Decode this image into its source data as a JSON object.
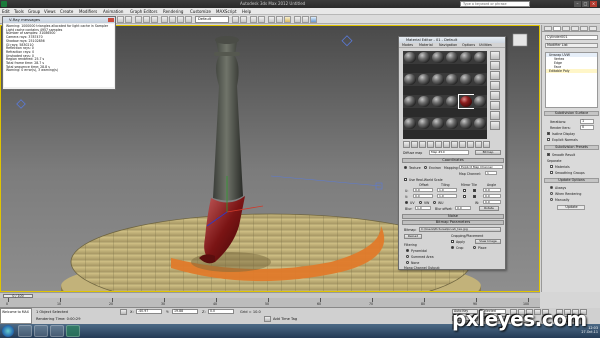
{
  "titlebar": {
    "title": "Autodesk 3ds Max 2012   Untitled",
    "search_placeholder": "Type a keyword or phrase"
  },
  "menus": [
    "Edit",
    "Tools",
    "Group",
    "Views",
    "Create",
    "Modifiers",
    "Animation",
    "Graph Editors",
    "Rendering",
    "Customize",
    "MAXScript",
    "Help"
  ],
  "toolbar": {
    "selection_filter": "All",
    "named_selection": "Default"
  },
  "viewport": {
    "label": "[ + ][Perspective][Smooth + Highlights]"
  },
  "vray_messages": {
    "title": "V-Ray messages",
    "lines": [
      "Warning: 1000000 triangles allocated for light cache in Sampler",
      "Light cache contains 4957 samples",
      "Number of samples: 31086500",
      "Camera rays: 3787470",
      "Shadow rays: 25102856",
      "GI rays: 5830210",
      "Reflection rays: 0",
      "Refraction rays: 0",
      "Unshaded rays: 0",
      "Region rendered: 25.7 s",
      "Total frame time: 28.7 s",
      "Total sequence time: 28.8 s",
      "Warning: 0 error(s), 3 warning(s)"
    ]
  },
  "command_panel": {
    "object_name": "Cylinder001",
    "modifier_list": "Modifier List",
    "stack": [
      "Unwrap UVW",
      "Vertex",
      "Edge",
      "Face",
      "Editable Poly"
    ],
    "rollouts": [
      "Subdivision Surface",
      "Subdivision Presets",
      "Update Options"
    ],
    "params": {
      "iterations_label": "Iterations:",
      "iterations": "1",
      "render_iters_label": "Render Iters:",
      "render_iters": "0",
      "isoline_label": "Isoline Display",
      "explicit_normals_label": "Explicit Normals",
      "smooth_result_label": "Smooth Result",
      "separate_label": "Separate",
      "materials_label": "Materials",
      "smoothing_groups_label": "Smoothing Groups",
      "always_label": "Always",
      "when_rendering_label": "When Rendering",
      "manually_label": "Manually",
      "update_label": "Update"
    }
  },
  "material_editor": {
    "title": "Material Editor - 01 - Default",
    "menu": [
      "Modes",
      "Material",
      "Navigation",
      "Options",
      "Utilities"
    ],
    "material_name": "Diffuse map",
    "map_name": "Map #10",
    "map_type": "Bitmap",
    "rollouts": [
      "Coordinates",
      "Noise",
      "Bitmap Parameters"
    ],
    "coords": {
      "texture_label": "Texture",
      "environ_label": "Environ",
      "mapping_label": "Mapping:",
      "mapping_value": "Explicit Map Channel",
      "map_channel_label": "Map Channel:",
      "map_channel_value": "1",
      "use_real_world": "Use Real-World Scale",
      "offset_label": "Offset",
      "tiling_label": "Tiling",
      "mirror_tile_label": "Mirror Tile",
      "angle_label": "Angle",
      "u_label": "U:",
      "v_label": "V:",
      "w_label": "W:",
      "u_offset": "0.0",
      "v_offset": "0.0",
      "u_tiling": "1.0",
      "v_tiling": "1.0",
      "u_angle": "0.0",
      "v_angle": "0.0",
      "w_angle": "0.0",
      "uv_label": "UV",
      "vw_label": "VW",
      "wu_label": "WU",
      "blur_label": "Blur:",
      "blur_value": "1.0",
      "blur_offset_label": "Blur offset:",
      "blur_offset_value": "0.0",
      "rotate_label": "Rotate"
    },
    "bitmap": {
      "bitmap_label": "Bitmap:",
      "bitmap_path": "C:\\Users\\Pictures\\brush_tex.jpg",
      "reload_label": "Reload",
      "cropping_label": "Cropping/Placement",
      "apply_label": "Apply",
      "view_image_label": "View Image",
      "crop_label": "Crop",
      "place_label": "Place",
      "filtering_label": "Filtering",
      "pyramidal_label": "Pyramidal",
      "summed_area_label": "Summed Area",
      "none_label": "None",
      "mono_channel_label": "Mono Channel Output:"
    }
  },
  "timeline": {
    "frame_label": "0 / 100",
    "ticks": [
      "0",
      "10",
      "20",
      "30",
      "40",
      "50",
      "60",
      "70",
      "80",
      "90",
      "100"
    ]
  },
  "statusbar": {
    "maxscript": "Welcome to MAX",
    "selected": "1 Object Selected",
    "rendering_time": "Rendering Time: 0:00:29",
    "x_label": "X:",
    "x_value": "-40.97",
    "y_label": "Y:",
    "y_value": "19.88",
    "z_label": "Z:",
    "z_value": "0.0",
    "grid": "Grid = 10.0",
    "auto_key": "Auto Key",
    "selected_btn": "Selected",
    "set_key": "Set Key",
    "key_filters": "Key Filters...",
    "add_time_tag": "Add Time Tag"
  },
  "taskbar": {
    "time": "12:03",
    "date": "27.Oct.11"
  },
  "watermark": "pxleyes.com",
  "colors": {
    "viewport_border": "#e0c400",
    "accent_red": "#8a1d1d",
    "floor_orange": "#e07a2a"
  }
}
